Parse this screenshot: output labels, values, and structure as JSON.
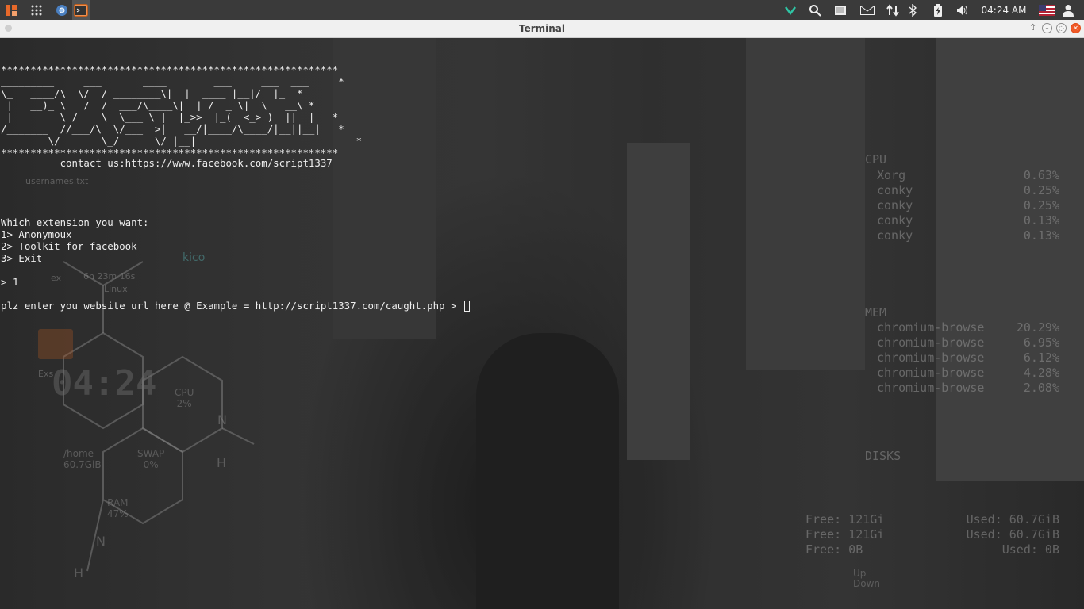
{
  "topbar": {
    "clock": "04:24 AM",
    "icons": [
      "app-menu-icon",
      "apps-grid-icon",
      "chromium-icon",
      "terminal-app-icon",
      "network-icon",
      "search-icon",
      "display-icon",
      "mail-icon",
      "transfer-icon",
      "bluetooth-icon",
      "battery-icon",
      "volume-icon",
      "us-flag-icon",
      "user-icon"
    ]
  },
  "window": {
    "title": "Terminal"
  },
  "terminal": {
    "banner": "*********************************************************\n_________     ___       ____        ___     ___  ___     *\n\\_   ____/\\  \\/  / ________\\|  |  ____ |__|/  |_  *\n |   __)_ \\   /  /  ___/\\____\\|  | /  _ \\|  \\   __\\ *\n |        \\ /    \\  \\___ \\ |  |_>>  |_(  <_> )  ||  |   *\n/_______  //___/\\  \\/___  >|   __/|____/\\____/|__||__|   *\n        \\/       \\_/      \\/ |__|                           *\n*********************************************************",
    "contact": "          contact us:https://www.facebook.com/script1337",
    "question": "Which extension you want:",
    "options": [
      "1> Anonymoux",
      "2> Toolkit for facebook",
      "3> Exit"
    ],
    "answer": "> 1",
    "prompt": "plz enter you website url here @ Example = http://script1337.com/caught.php > "
  },
  "desktop": {
    "icons": [
      "usernames.txt",
      "Exs"
    ],
    "conky_clock": "04:24",
    "conky_chem": {
      "cpu_label": "CPU",
      "cpu_value": "2%",
      "home_label": "/home",
      "home_value": "60.7GiB",
      "swap_label": "SWAP",
      "swap_value": "0%",
      "ram_label": "RAM",
      "ram_value": "47%",
      "n1": "N",
      "h1": "H",
      "n2": "N",
      "h2": "H",
      "kicd": "kico",
      "uptime": "6h 23m 16s",
      "os": "Linux",
      "ex": "ex"
    },
    "conky_right": {
      "cpu_header": "CPU",
      "cpu_procs": [
        {
          "name": "Xorg",
          "value": "0.63%"
        },
        {
          "name": "conky",
          "value": "0.25%"
        },
        {
          "name": "conky",
          "value": "0.25%"
        },
        {
          "name": "conky",
          "value": "0.13%"
        },
        {
          "name": "conky",
          "value": "0.13%"
        }
      ],
      "mem_header": "MEM",
      "mem_procs": [
        {
          "name": "chromium-browse",
          "value": "20.29%"
        },
        {
          "name": "chromium-browse",
          "value": "6.95%"
        },
        {
          "name": "chromium-browse",
          "value": "6.12%"
        },
        {
          "name": "chromium-browse",
          "value": "4.28%"
        },
        {
          "name": "chromium-browse",
          "value": "2.08%"
        }
      ],
      "disks_header": "DISKS",
      "disks": [
        {
          "free": "Free: 121Gi",
          "used": "Used: 60.7GiB"
        },
        {
          "free": "Free: 121Gi",
          "used": "Used: 60.7GiB"
        },
        {
          "free": "Free: 0B",
          "used": "Used: 0B"
        }
      ],
      "net_up": "Up",
      "net_down": "Down"
    }
  }
}
